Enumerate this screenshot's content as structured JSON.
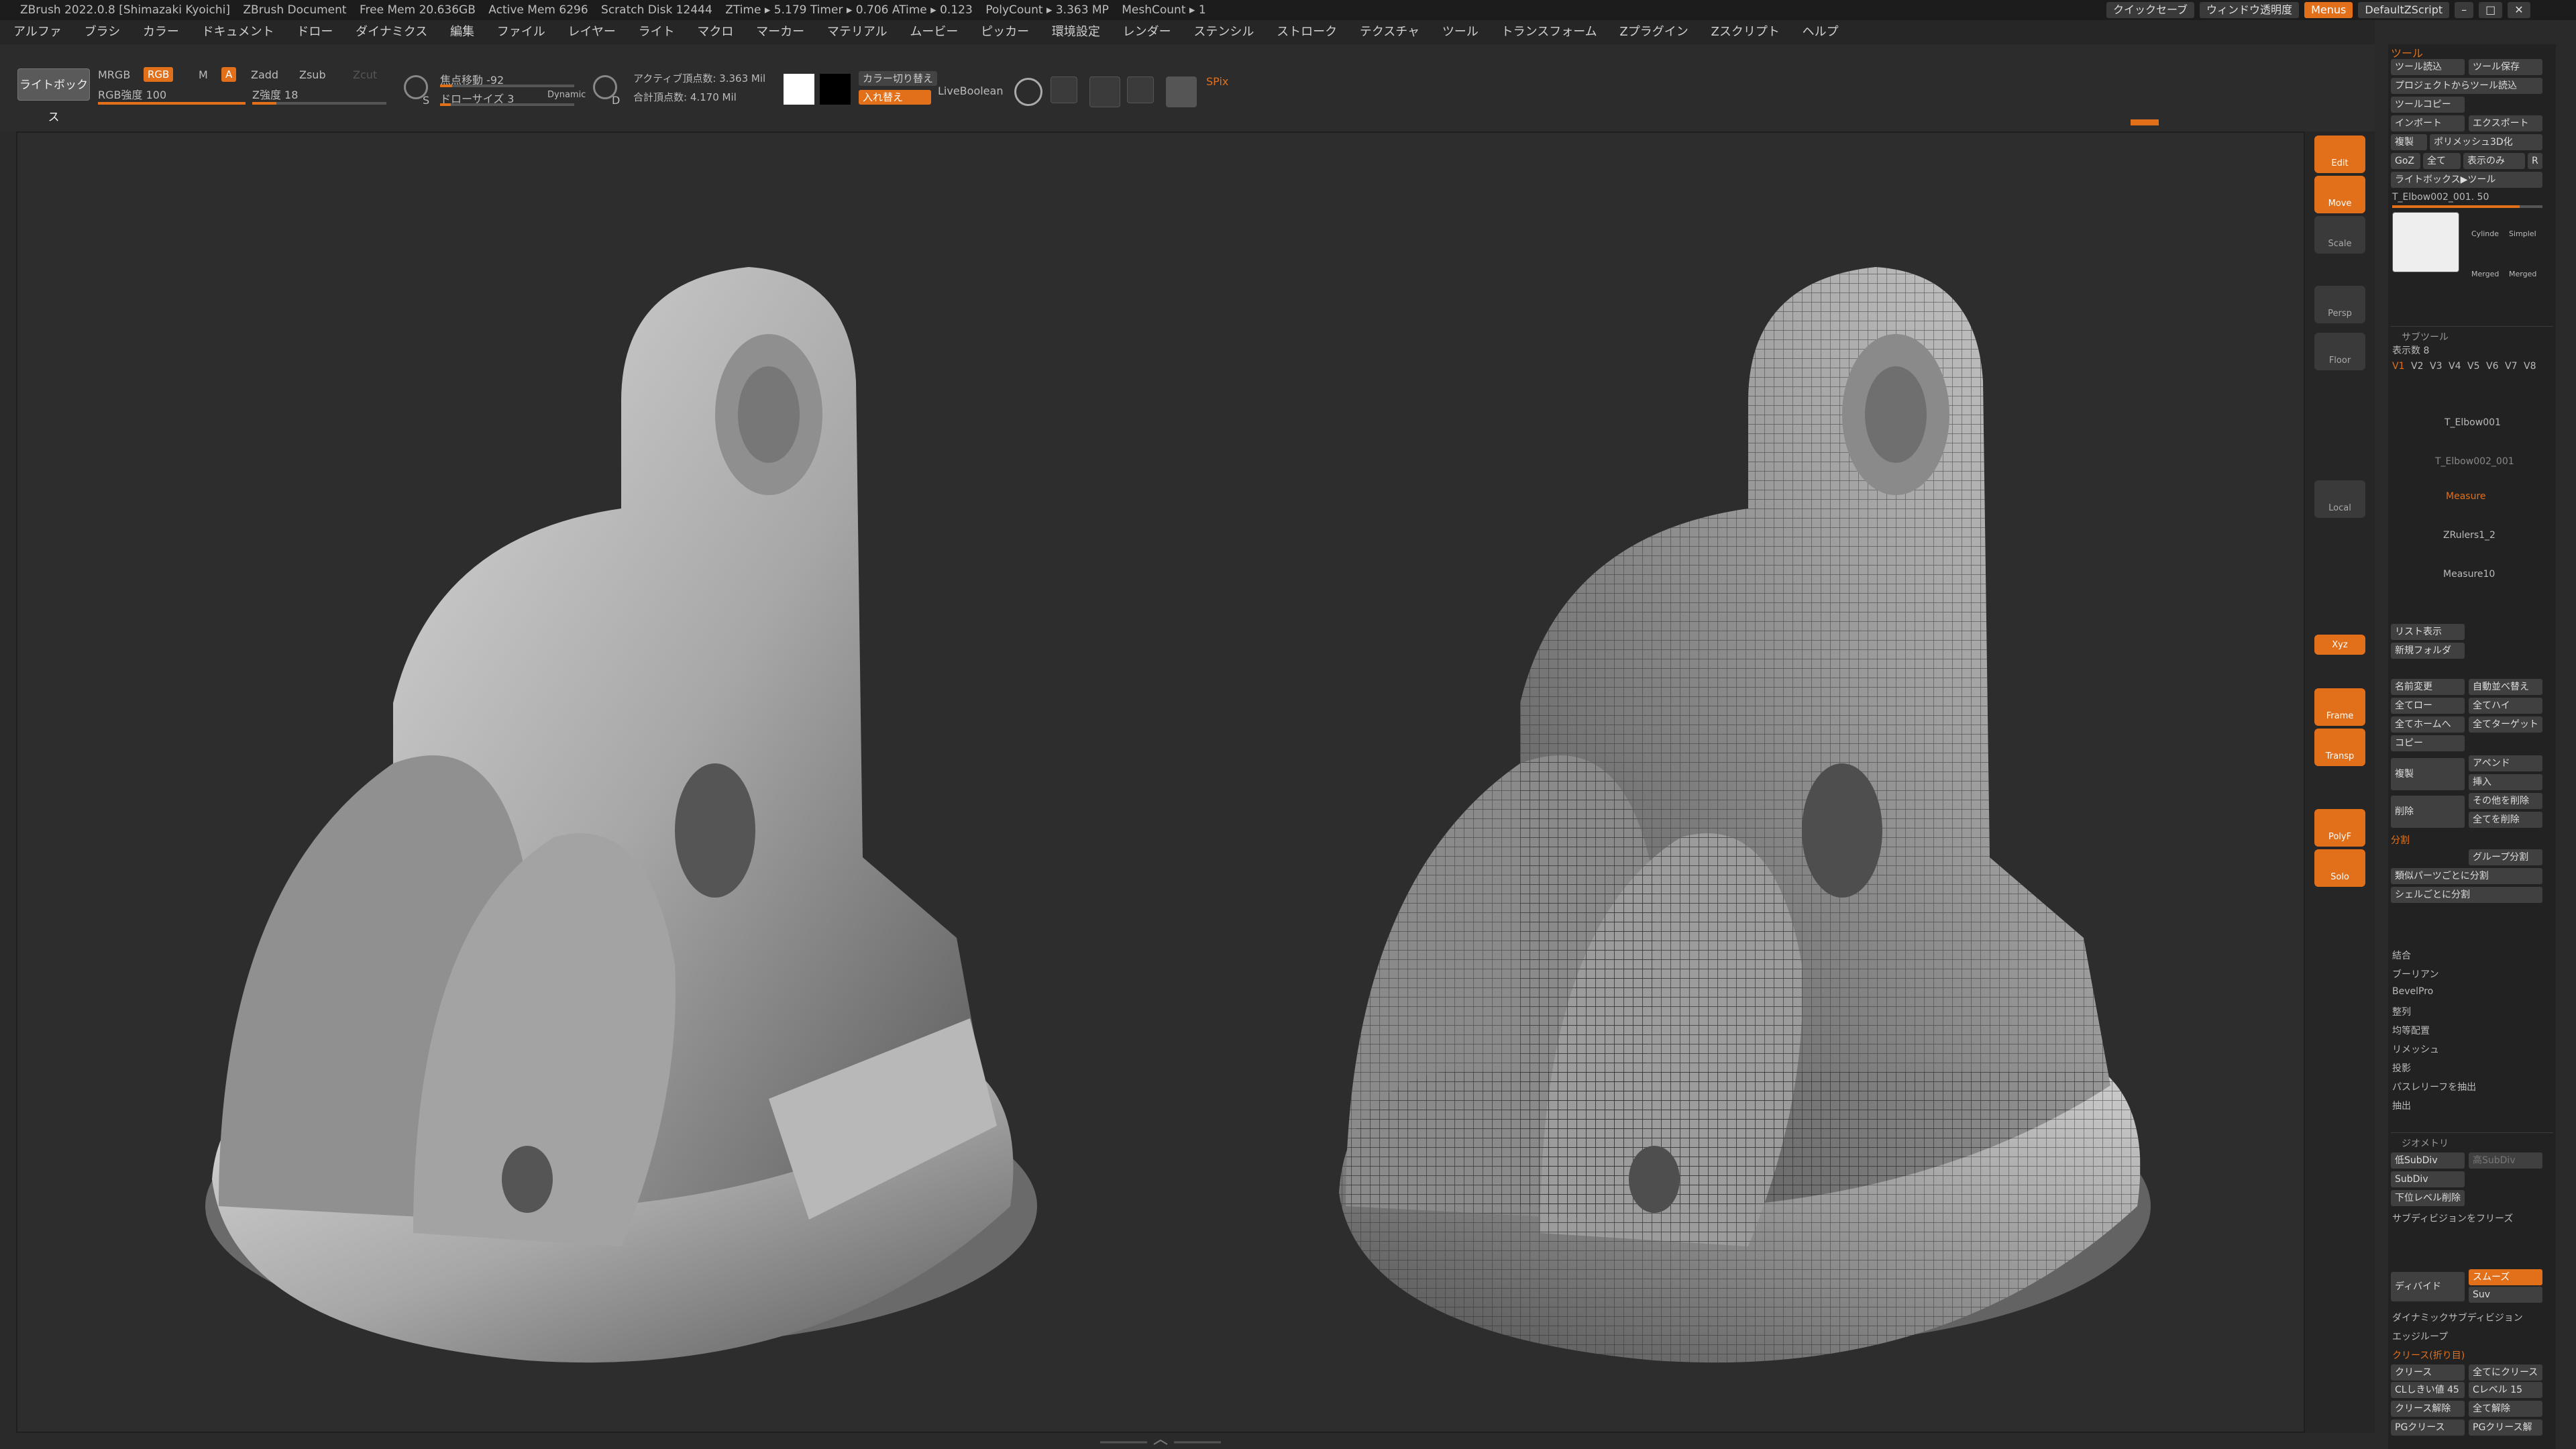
{
  "titlebar": {
    "app": "ZBrush 2022.0.8 [Shimazaki Kyoichi]",
    "document": "ZBrush Document",
    "free_mem": "Free Mem 20.636GB",
    "active_mem": "Active Mem 6296",
    "scratch": "Scratch Disk 12444",
    "ztime": "ZTime ▸ 5.179 Timer ▸ 0.706 ATime ▸ 0.123",
    "polycount": "PolyCount ▸ 3.363 MP",
    "meshcount": "MeshCount ▸ 1",
    "quicksave": "クイックセーブ",
    "window_transparency": "ウィンドウ透明度",
    "menus": "Menus",
    "default_script": "DefaultZScript"
  },
  "menubar": [
    "アルファ",
    "ブラシ",
    "カラー",
    "ドキュメント",
    "ドロー",
    "ダイナミクス",
    "編集",
    "ファイル",
    "レイヤー",
    "ライト",
    "マクロ",
    "マーカー",
    "マテリアル",
    "ムービー",
    "ピッカー",
    "環境設定",
    "レンダー",
    "ステンシル",
    "ストローク",
    "テクスチャ",
    "ツール",
    "トランスフォーム",
    "Zプラグイン",
    "Zスクリプト",
    "ヘルプ"
  ],
  "toolbar": {
    "lightbox": "ライトボックス",
    "mrgb": "MRGB",
    "rgb": "RGB",
    "m": "M",
    "a": "A",
    "zadd": "Zadd",
    "zsub": "Zsub",
    "zcut": "Zcut",
    "rgb_intensity": "RGB強度 100",
    "z_intensity": "Z強度 18",
    "focal_shift": "焦点移動 -92",
    "draw_size": "ドローサイズ 3",
    "dynamic": "Dynamic",
    "active_points": "アクティブ頂点数: 3.363 Mil",
    "total_points": "合計頂点数: 4.170 Mil",
    "color_switch": "カラー切り替え",
    "swap": "入れ替え",
    "livebool": "LiveBoolean",
    "spix": "SPix",
    "s_label": "S",
    "d_label": "D",
    "color_primary": "#ffffff",
    "color_secondary": "#000000",
    "accent": "#e2701a"
  },
  "shelf": {
    "edit": "Edit",
    "move": "Move",
    "scale": "Scale",
    "perspective": "Persp",
    "floor": "Floor",
    "local": "Local",
    "frame": "Frame",
    "transp": "Transp",
    "polyf": "PolyF",
    "solo": "Solo",
    "xyz": "Xyz"
  },
  "panel": {
    "header": "ツール",
    "load_tool": "ツール読込",
    "save_tool": "ツール保存",
    "load_project": "プロジェクトからツール読込",
    "copy_tool": "ツールコピー",
    "import": "インポート",
    "export": "エクスポート",
    "clone": "複製",
    "make_polymesh": "ポリメッシュ3D化",
    "goz": "GoZ",
    "all": "全て",
    "visible": "表示のみ",
    "r": "R",
    "lightbox_tool": "ライトボックス▶ツール",
    "tool_name": "T_Elbow002_001. 50",
    "thumbs": [
      "Cylinde",
      "SimpleI",
      "Merged",
      "Merged"
    ],
    "subtool_title": "サブツール",
    "visible_count": "表示数 8",
    "v_tabs": [
      "V1",
      "V2",
      "V3",
      "V4",
      "V5",
      "V6",
      "V7",
      "V8"
    ],
    "subtools": [
      "T_Elbow001",
      "T_Elbow002_001",
      "Measure",
      "ZRulers1_2",
      "Measure10"
    ],
    "list_view": "リスト表示",
    "new_folder": "新規フォルダ",
    "rename": "名前変更",
    "auto_reorder": "自動並べ替え",
    "all_low": "全てロー",
    "all_high": "全てハイ",
    "all_to_home": "全てホームへ",
    "all_to_target": "全てターゲット",
    "copy": "コピー",
    "duplicate": "複製",
    "append": "アペンド",
    "insert": "挿入",
    "delete": "削除",
    "delete_other": "その他を削除",
    "delete_all": "全てを削除",
    "split": "分割",
    "group_split": "グループ分割",
    "split_similar": "類似パーツごとに分割",
    "split_shell": "シェルごとに分割",
    "merge": "結合",
    "boolean": "ブーリアン",
    "bevelpro": "BevelPro",
    "align": "整列",
    "distribute": "均等配置",
    "remesh": "リメッシュ",
    "project": "投影",
    "extract_relief": "パスレリーフを抽出",
    "extract": "抽出",
    "geometry_title": "ジオメトリ",
    "lower_subdiv": "低SubDiv",
    "higher_subdiv": "高SubDiv",
    "subdiv_level": "SubDiv",
    "delete_lower": "下位レベル削除",
    "freeze_subdiv": "サブディビジョンをフリーズ",
    "divide": "ディバイド",
    "smooth": "スムーズ",
    "suv": "Suv",
    "dynamic_subdiv": "ダイナミックサブディビジョン",
    "edge_loop": "エッジループ",
    "crease_title": "クリース(折り目)",
    "crease": "クリース",
    "crease_all": "全てにクリース",
    "crease_threshold": "CLしきい値 45",
    "crease_level": "Cレベル 15",
    "uncrease": "クリース解除",
    "uncrease_all": "全て解除",
    "pg_crease": "PGクリース",
    "pg_uncrease": "PGクリース解"
  }
}
